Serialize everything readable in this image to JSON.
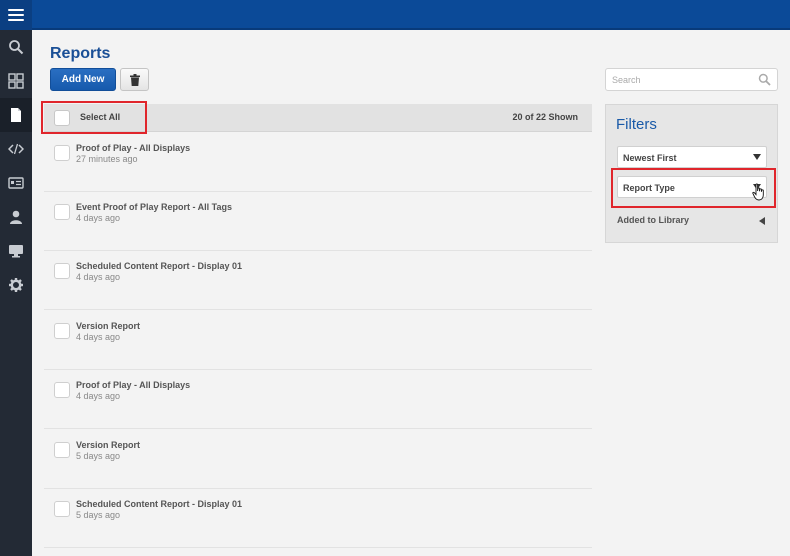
{
  "page": {
    "title": "Reports"
  },
  "toolbar": {
    "add_new_label": "Add New",
    "delete_icon": "trash-icon"
  },
  "select_bar": {
    "select_all_label": "Select All",
    "shown_count": "20 of 22 Shown"
  },
  "reports": [
    {
      "title": "Proof of Play - All Displays",
      "time": "27 minutes ago"
    },
    {
      "title": "Event Proof of Play Report - All Tags",
      "time": "4 days ago"
    },
    {
      "title": "Scheduled Content Report - Display 01",
      "time": "4 days ago"
    },
    {
      "title": "Version Report",
      "time": "4 days ago"
    },
    {
      "title": "Proof of Play - All Displays",
      "time": "4 days ago"
    },
    {
      "title": "Version Report",
      "time": "5 days ago"
    },
    {
      "title": "Scheduled Content Report - Display 01",
      "time": "5 days ago"
    }
  ],
  "search": {
    "placeholder": "Search"
  },
  "filters": {
    "title": "Filters",
    "sort_selected": "Newest First",
    "report_type_selected": "Report Type",
    "added_to_library_label": "Added to Library"
  },
  "sidebar": {
    "icons": [
      "search-icon",
      "dashboard-icon",
      "document-icon",
      "code-icon",
      "id-card-icon",
      "user-icon",
      "monitor-icon",
      "gear-icon"
    ],
    "active": "document-icon"
  },
  "colors": {
    "topbar": "#0b4a98",
    "sidebar": "#232a35",
    "accent": "#1a5aa8",
    "highlight": "#e0262c"
  }
}
